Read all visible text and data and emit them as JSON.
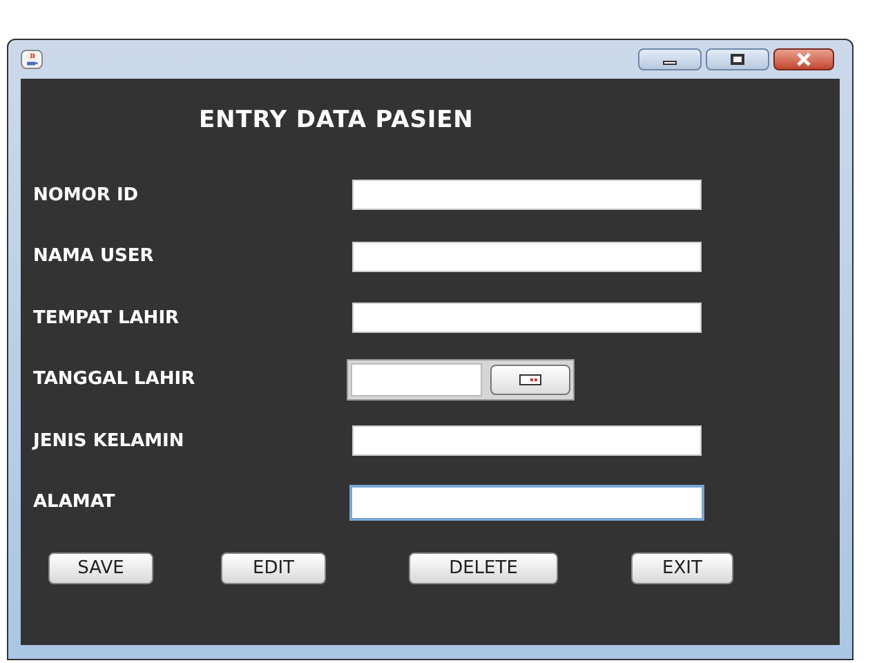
{
  "heading": "ENTRY DATA PASIEN",
  "fields": [
    {
      "label": "NOMOR ID",
      "kind": "text",
      "focused": false
    },
    {
      "label": "NAMA USER",
      "kind": "text",
      "focused": false
    },
    {
      "label": "TEMPAT LAHIR",
      "kind": "text",
      "focused": false
    },
    {
      "label": "TANGGAL LAHIR",
      "kind": "date",
      "focused": false
    },
    {
      "label": "JENIS KELAMIN",
      "kind": "text",
      "focused": false
    },
    {
      "label": "ALAMAT",
      "kind": "text",
      "focused": true
    }
  ],
  "buttons": [
    "SAVE",
    "EDIT",
    "DELETE",
    "EXIT"
  ]
}
